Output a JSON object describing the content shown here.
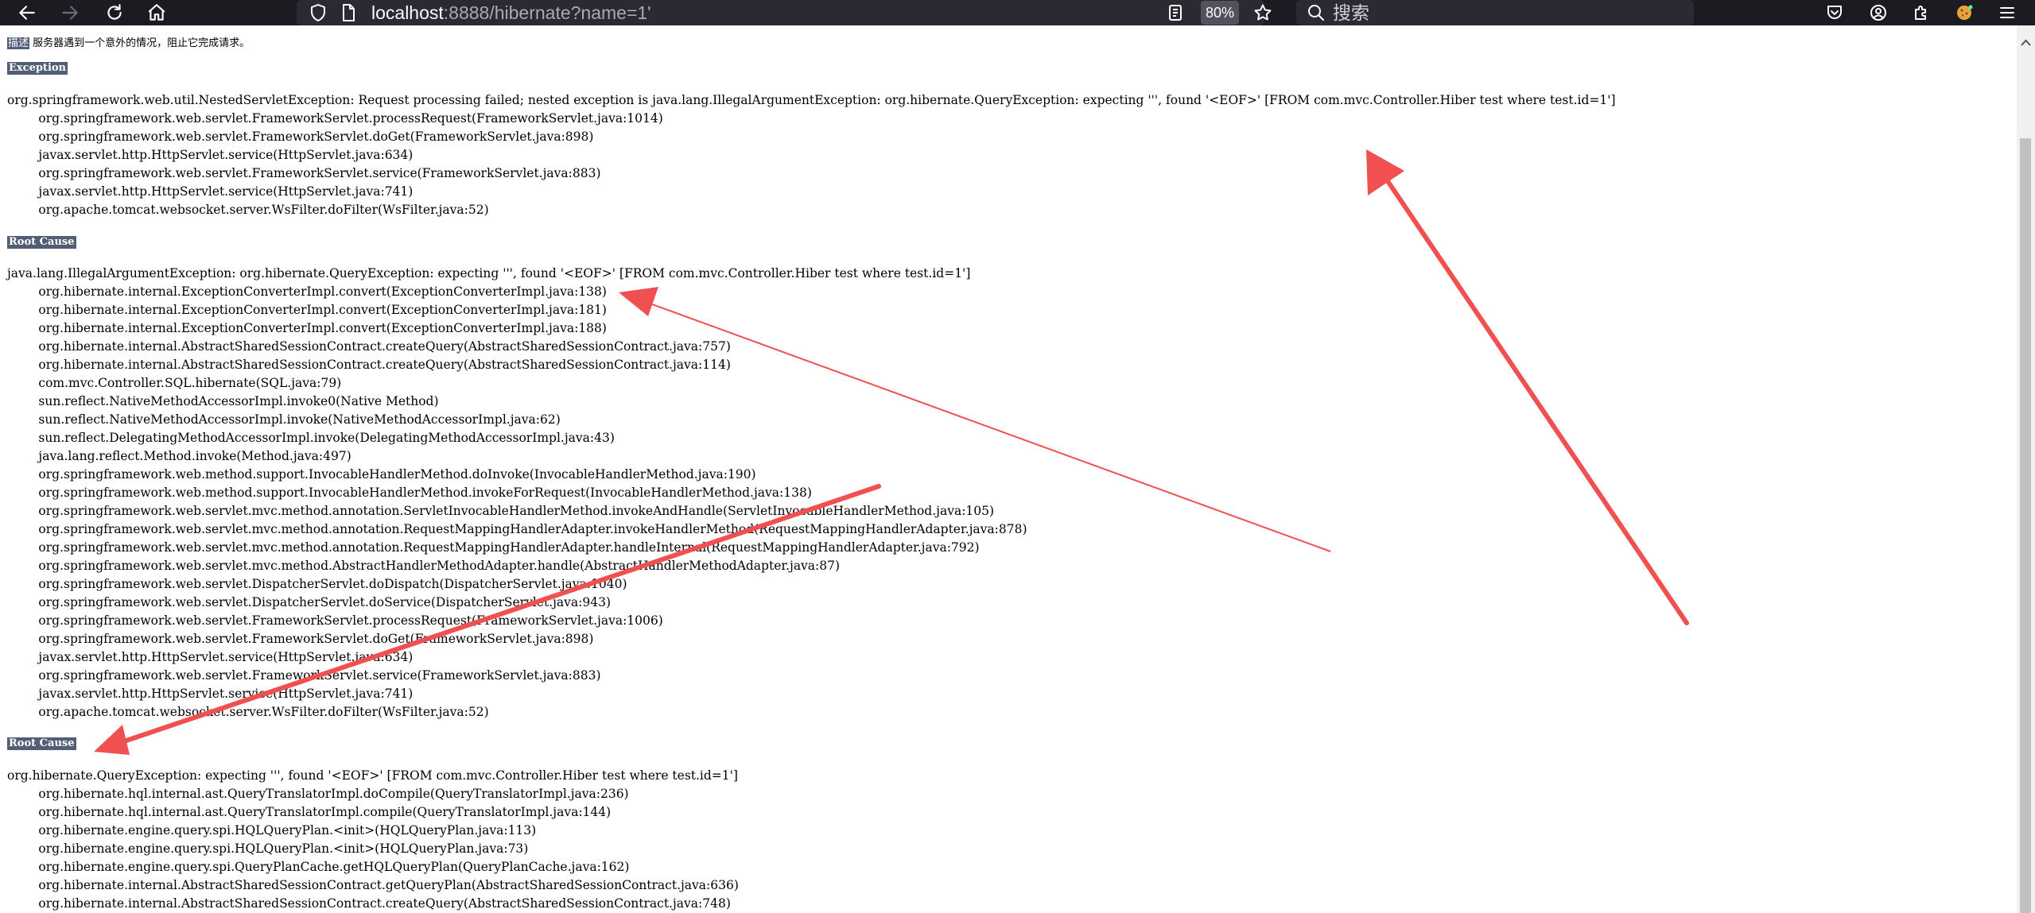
{
  "browser": {
    "url_host": "localhost",
    "url_rest": ":8888/hibernate?name=1'",
    "zoom": "80%",
    "search_placeholder": "搜索",
    "icons": [
      "back-icon",
      "forward-icon",
      "reload-icon",
      "home-icon",
      "shield-icon",
      "page-icon",
      "reader-view-icon",
      "bookmark-star-icon",
      "search-icon",
      "pocket-icon",
      "account-icon",
      "extensions-icon",
      "extension-cookie-icon",
      "menu-icon"
    ]
  },
  "page": {
    "description_label": "描述",
    "description_text": "服务器遇到一个意外的情况，阻止它完成请求。",
    "exception_label": "Exception",
    "exception_trace": [
      "org.springframework.web.util.NestedServletException: Request processing failed; nested exception is java.lang.IllegalArgumentException: org.hibernate.QueryException: expecting ''', found '<EOF>' [FROM com.mvc.Controller.Hiber test where test.id=1']",
      "\torg.springframework.web.servlet.FrameworkServlet.processRequest(FrameworkServlet.java:1014)",
      "\torg.springframework.web.servlet.FrameworkServlet.doGet(FrameworkServlet.java:898)",
      "\tjavax.servlet.http.HttpServlet.service(HttpServlet.java:634)",
      "\torg.springframework.web.servlet.FrameworkServlet.service(FrameworkServlet.java:883)",
      "\tjavax.servlet.http.HttpServlet.service(HttpServlet.java:741)",
      "\torg.apache.tomcat.websocket.server.WsFilter.doFilter(WsFilter.java:52)"
    ],
    "root_cause_label_1": "Root Cause",
    "root_cause_trace_1": [
      "java.lang.IllegalArgumentException: org.hibernate.QueryException: expecting ''', found '<EOF>' [FROM com.mvc.Controller.Hiber test where test.id=1']",
      "\torg.hibernate.internal.ExceptionConverterImpl.convert(ExceptionConverterImpl.java:138)",
      "\torg.hibernate.internal.ExceptionConverterImpl.convert(ExceptionConverterImpl.java:181)",
      "\torg.hibernate.internal.ExceptionConverterImpl.convert(ExceptionConverterImpl.java:188)",
      "\torg.hibernate.internal.AbstractSharedSessionContract.createQuery(AbstractSharedSessionContract.java:757)",
      "\torg.hibernate.internal.AbstractSharedSessionContract.createQuery(AbstractSharedSessionContract.java:114)",
      "\tcom.mvc.Controller.SQL.hibernate(SQL.java:79)",
      "\tsun.reflect.NativeMethodAccessorImpl.invoke0(Native Method)",
      "\tsun.reflect.NativeMethodAccessorImpl.invoke(NativeMethodAccessorImpl.java:62)",
      "\tsun.reflect.DelegatingMethodAccessorImpl.invoke(DelegatingMethodAccessorImpl.java:43)",
      "\tjava.lang.reflect.Method.invoke(Method.java:497)",
      "\torg.springframework.web.method.support.InvocableHandlerMethod.doInvoke(InvocableHandlerMethod.java:190)",
      "\torg.springframework.web.method.support.InvocableHandlerMethod.invokeForRequest(InvocableHandlerMethod.java:138)",
      "\torg.springframework.web.servlet.mvc.method.annotation.ServletInvocableHandlerMethod.invokeAndHandle(ServletInvocableHandlerMethod.java:105)",
      "\torg.springframework.web.servlet.mvc.method.annotation.RequestMappingHandlerAdapter.invokeHandlerMethod(RequestMappingHandlerAdapter.java:878)",
      "\torg.springframework.web.servlet.mvc.method.annotation.RequestMappingHandlerAdapter.handleInternal(RequestMappingHandlerAdapter.java:792)",
      "\torg.springframework.web.servlet.mvc.method.AbstractHandlerMethodAdapter.handle(AbstractHandlerMethodAdapter.java:87)",
      "\torg.springframework.web.servlet.DispatcherServlet.doDispatch(DispatcherServlet.java:1040)",
      "\torg.springframework.web.servlet.DispatcherServlet.doService(DispatcherServlet.java:943)",
      "\torg.springframework.web.servlet.FrameworkServlet.processRequest(FrameworkServlet.java:1006)",
      "\torg.springframework.web.servlet.FrameworkServlet.doGet(FrameworkServlet.java:898)",
      "\tjavax.servlet.http.HttpServlet.service(HttpServlet.java:634)",
      "\torg.springframework.web.servlet.FrameworkServlet.service(FrameworkServlet.java:883)",
      "\tjavax.servlet.http.HttpServlet.service(HttpServlet.java:741)",
      "\torg.apache.tomcat.websocket.server.WsFilter.doFilter(WsFilter.java:52)"
    ],
    "root_cause_label_2": "Root Cause",
    "root_cause_trace_2": [
      "org.hibernate.QueryException: expecting ''', found '<EOF>' [FROM com.mvc.Controller.Hiber test where test.id=1']",
      "\torg.hibernate.hql.internal.ast.QueryTranslatorImpl.doCompile(QueryTranslatorImpl.java:236)",
      "\torg.hibernate.hql.internal.ast.QueryTranslatorImpl.compile(QueryTranslatorImpl.java:144)",
      "\torg.hibernate.engine.query.spi.HQLQueryPlan.<init>(HQLQueryPlan.java:113)",
      "\torg.hibernate.engine.query.spi.HQLQueryPlan.<init>(HQLQueryPlan.java:73)",
      "\torg.hibernate.engine.query.spi.QueryPlanCache.getHQLQueryPlan(QueryPlanCache.java:162)",
      "\torg.hibernate.internal.AbstractSharedSessionContract.getQueryPlan(AbstractSharedSessionContract.java:636)",
      "\torg.hibernate.internal.AbstractSharedSessionContract.createQuery(AbstractSharedSessionContract.java:748)"
    ]
  },
  "annotation_color": "#f0504f"
}
